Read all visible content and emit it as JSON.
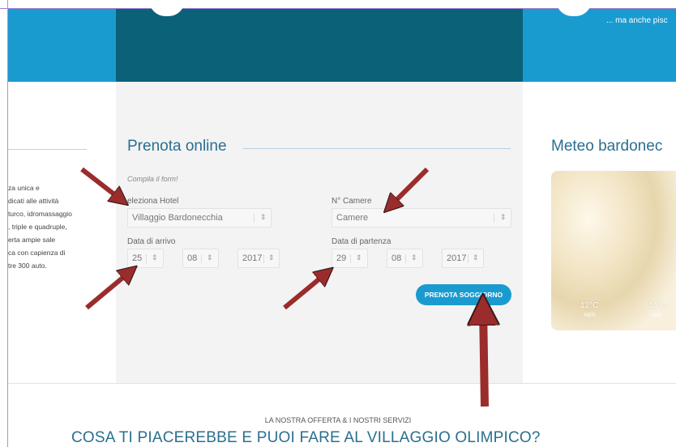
{
  "banner": {
    "caption": "... ma anche pisc"
  },
  "left_column": {
    "lines": [
      "za unica e",
      "dicati alle attività",
      "turco, idromassaggio",
      ", triple e quadruple,",
      "erta ampie sale",
      "ca con capienza di",
      "tre 300 auto."
    ]
  },
  "booking": {
    "title": "Prenota online",
    "subtitle": "Compila il form!",
    "hotel_label": "eleziona Hotel",
    "hotel_value": "Villaggio Bardonecchia",
    "rooms_label": "N° Camere",
    "rooms_value": "Camere",
    "arrival_label": "Data di arrivo",
    "arrival_day": "25",
    "arrival_month": "08",
    "arrival_year": "2017",
    "departure_label": "Data di partenza",
    "departure_day": "29",
    "departure_month": "08",
    "departure_year": "2017",
    "submit_label": "PRENOTA SOGGIORNO"
  },
  "meteo": {
    "title": "Meteo bardonec",
    "forecast": [
      {
        "temp": "12°C",
        "day": "MER"
      },
      {
        "temp": "14°C",
        "day": "GIO"
      }
    ]
  },
  "offer": {
    "kicker": "LA NOSTRA OFFERTA & I NOSTRI SERVIZI",
    "headline": "COSA TI PIACEREBBE E PUOI FARE AL VILLAGGIO OLIMPICO?"
  },
  "icons": {
    "select_arrow": "chevron-updown-icon",
    "annotation": "red-arrow-annotation"
  },
  "colors": {
    "accent_blue": "#1a9bd0",
    "dark_teal": "#0b6178",
    "title_blue": "#2a6f8f",
    "annotation_red": "#9b2c2c"
  }
}
